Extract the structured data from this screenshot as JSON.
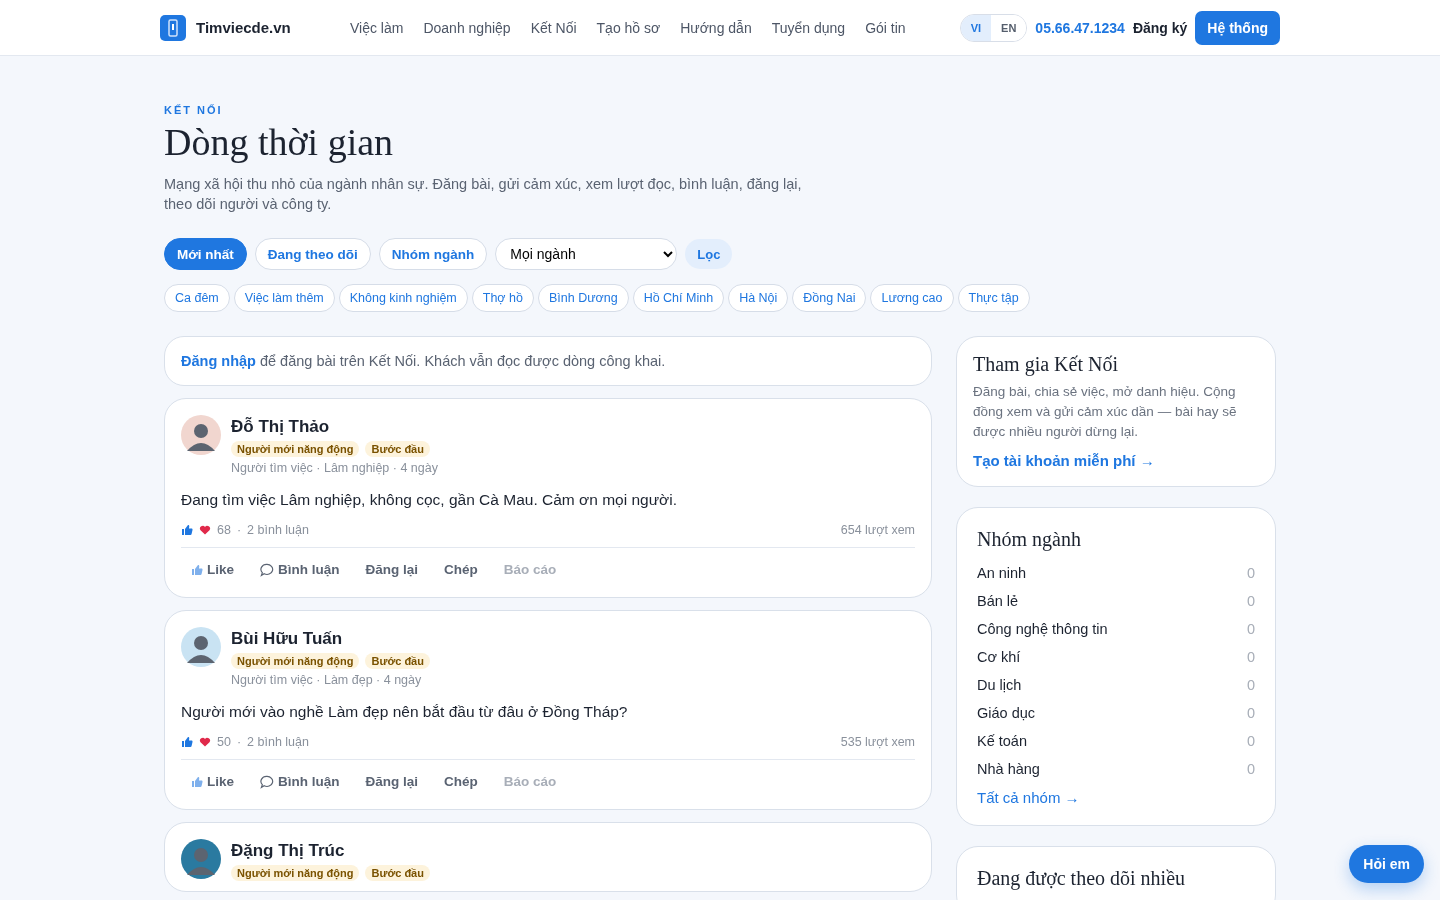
{
  "header": {
    "logo": "Timviecde.vn",
    "nav": [
      "Việc làm",
      "Doanh nghiệp",
      "Kết Nối",
      "Tạo hồ sơ",
      "Hướng dẫn",
      "Tuyển dụng",
      "Gói tin"
    ],
    "languages": [
      {
        "label": "VI",
        "selected": true
      },
      {
        "label": "EN",
        "selected": false
      }
    ],
    "phone": "05.66.47.1234",
    "register": "Đăng ký",
    "system_button": "Hệ thống"
  },
  "hero": {
    "eyebrow": "KẾT NỐI",
    "title": "Dòng thời gian",
    "subtitle": "Mạng xã hội thu nhỏ của ngành nhân sự. Đăng bài, gửi cảm xúc, xem lượt đọc, bình luận, đăng lại, theo dõi người và công ty."
  },
  "filters": {
    "tabs": [
      {
        "label": "Mới nhất",
        "selected": true
      },
      {
        "label": "Đang theo dõi",
        "selected": false
      },
      {
        "label": "Nhóm ngành",
        "selected": false
      }
    ],
    "select": "Mọi ngành",
    "filter_button": "Lọc",
    "tags": [
      "Ca đêm",
      "Việc làm thêm",
      "Không kinh nghiệm",
      "Thợ hồ",
      "Bình Dương",
      "Hồ Chí Minh",
      "Hà Nội",
      "Đồng Nai",
      "Lương cao",
      "Thực tập"
    ]
  },
  "login_notice": {
    "link": "Đăng nhập",
    "text": "để đăng bài trên Kết Nối. Khách vẫn đọc được dòng công khai."
  },
  "posts": [
    {
      "author": "Đỗ Thị Thảo",
      "badges": [
        "Người mới năng động",
        "Bước đầu"
      ],
      "meta": "Người tìm việc · Lâm nghiệp · 4 ngày",
      "body": "Đang tìm việc Lâm nghiệp, không cọc, gần Cà Mau. Cảm ơn mọi người.",
      "reactions": "68",
      "separator": "·",
      "comments": "2 bình luận",
      "views": "654 lượt xem",
      "actions": [
        {
          "label": "Like",
          "kind": "like",
          "disabled": false
        },
        {
          "label": "Bình luận",
          "kind": "comment",
          "disabled": false
        },
        {
          "label": "Đăng lại",
          "kind": "plain",
          "disabled": false
        },
        {
          "label": "Chép",
          "kind": "plain",
          "disabled": false
        },
        {
          "label": "Báo cáo",
          "kind": "plain",
          "disabled": true
        }
      ]
    },
    {
      "author": "Bùi Hữu Tuấn",
      "badges": [
        "Người mới năng động",
        "Bước đầu"
      ],
      "meta": "Người tìm việc · Làm đẹp · 4 ngày",
      "body": "Người mới vào nghề Làm đẹp nên bắt đầu từ đâu ở Đồng Tháp?",
      "reactions": "50",
      "separator": "·",
      "comments": "2 bình luận",
      "views": "535 lượt xem",
      "actions": [
        {
          "label": "Like",
          "kind": "like",
          "disabled": false
        },
        {
          "label": "Bình luận",
          "kind": "comment",
          "disabled": false
        },
        {
          "label": "Đăng lại",
          "kind": "plain",
          "disabled": false
        },
        {
          "label": "Chép",
          "kind": "plain",
          "disabled": false
        },
        {
          "label": "Báo cáo",
          "kind": "plain",
          "disabled": true
        }
      ]
    },
    {
      "author": "Đặng Thị Trúc",
      "badges": [
        "Người mới năng động",
        "Bước đầu"
      ]
    }
  ],
  "sidebar": {
    "join": {
      "title": "Tham gia Kết Nối",
      "text": "Đăng bài, chia sẻ việc, mở danh hiệu. Cộng đồng xem và gửi cảm xúc dần — bài hay sẽ được nhiều người dừng lại.",
      "link": "Tạo tài khoản miễn phí →"
    },
    "groups": {
      "title": "Nhóm ngành",
      "items": [
        {
          "name": "An ninh",
          "count": "0"
        },
        {
          "name": "Bán lẻ",
          "count": "0"
        },
        {
          "name": "Công nghệ thông tin",
          "count": "0"
        },
        {
          "name": "Cơ khí",
          "count": "0"
        },
        {
          "name": "Du lịch",
          "count": "0"
        },
        {
          "name": "Giáo dục",
          "count": "0"
        },
        {
          "name": "Kế toán",
          "count": "0"
        },
        {
          "name": "Nhà hàng",
          "count": "0"
        }
      ],
      "link": "Tất cả nhóm →"
    },
    "popular": {
      "title": "Đang được theo dõi nhiều"
    }
  },
  "chat_button": "Hỏi em"
}
